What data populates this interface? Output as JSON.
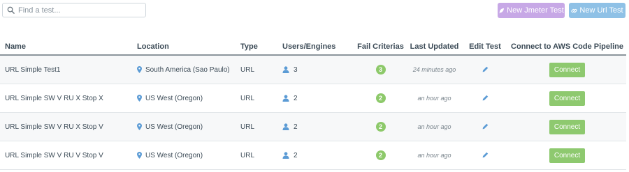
{
  "toolbar": {
    "search_placeholder": "Find a test...",
    "new_jmeter_label": "New Jmeter Test",
    "new_url_label": "New Url Test"
  },
  "columns": {
    "name": "Name",
    "location": "Location",
    "type": "Type",
    "users": "Users/Engines",
    "fail": "Fail Criterias",
    "updated": "Last Updated",
    "edit": "Edit Test",
    "connect": "Connect to AWS Code Pipeline"
  },
  "rows": [
    {
      "name": "URL Simple Test1",
      "location": "South America (Sao Paulo)",
      "type": "URL",
      "users": "3",
      "fail": "3",
      "updated": "24 minutes ago",
      "connect": "Connect"
    },
    {
      "name": "URL Simple SW V RU X Stop X",
      "location": "US West (Oregon)",
      "type": "URL",
      "users": "2",
      "fail": "2",
      "updated": "an hour ago",
      "connect": "Connect"
    },
    {
      "name": "URL Simple SW V RU X Stop V",
      "location": "US West (Oregon)",
      "type": "URL",
      "users": "2",
      "fail": "2",
      "updated": "an hour ago",
      "connect": "Connect"
    },
    {
      "name": "URL Simple SW V RU V Stop V",
      "location": "US West (Oregon)",
      "type": "URL",
      "users": "2",
      "fail": "2",
      "updated": "an hour ago",
      "connect": "Connect"
    }
  ],
  "icons": {
    "search": "search-icon",
    "jmeter": "feather-icon",
    "url": "link-icon",
    "location": "map-pin-icon",
    "users": "user-icon",
    "edit": "pencil-icon"
  },
  "colors": {
    "jmeter_button": "#c7a8e6",
    "url_button": "#8fc1e6",
    "connect_button": "#8ec96f",
    "badge": "#8dc96a",
    "icon_blue": "#5b9bd5"
  }
}
